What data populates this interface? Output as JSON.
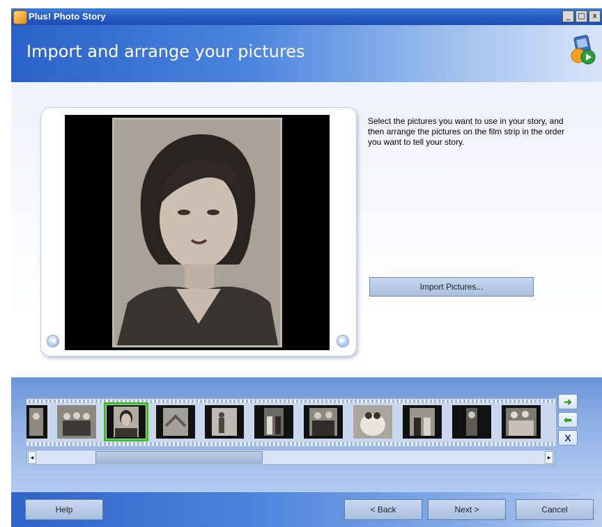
{
  "window": {
    "title": "Plus! Photo Story",
    "controls": {
      "minimize": "_",
      "maximize": "□",
      "close": "x"
    }
  },
  "header": {
    "page_title": "Import and arrange your pictures"
  },
  "preview": {
    "prev_icon": "chevron-left-icon",
    "next_icon": "chevron-right-icon"
  },
  "instructions": {
    "text": "Select the pictures you want to use in your story, and then arrange the pictures on the film strip in the order you want to tell your story."
  },
  "import_button": {
    "label": "Import Pictures..."
  },
  "filmstrip": {
    "thumbnail_count": 11,
    "selected_index": 2,
    "controls": {
      "move_right": "➜",
      "move_left": "⬅",
      "remove": "X"
    }
  },
  "footer": {
    "help": "Help",
    "back": "< Back",
    "next": "Next >",
    "cancel": "Cancel"
  },
  "colors": {
    "title_bar": "#2458c2",
    "selection": "#39c21a",
    "move_arrow": "#2a9d2a",
    "remove_x": "#1f3e8a"
  }
}
